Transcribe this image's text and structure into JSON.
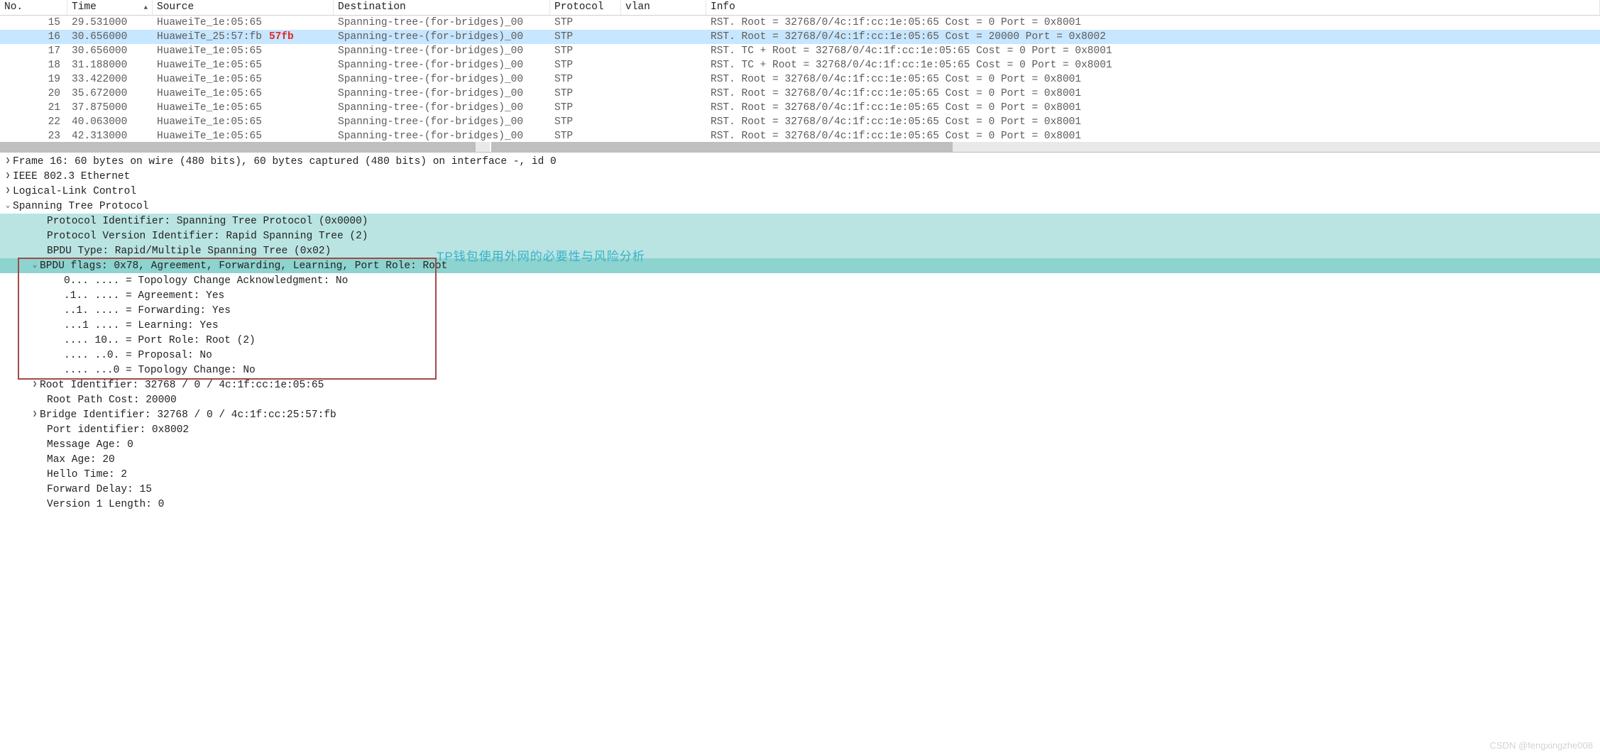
{
  "columns": {
    "no": "No.",
    "time": "Time",
    "src": "Source",
    "dst": "Destination",
    "proto": "Protocol",
    "vlan": "vlan",
    "info": "Info"
  },
  "annot_57fb": "57fb",
  "packets": [
    {
      "no": "15",
      "time": "29.531000",
      "src": "HuaweiTe_1e:05:65",
      "dst": "Spanning-tree-(for-bridges)_00",
      "proto": "STP",
      "info": "RST. Root = 32768/0/4c:1f:cc:1e:05:65  Cost = 0   Port = 0x8001"
    },
    {
      "no": "16",
      "time": "30.656000",
      "src": "HuaweiTe_25:57:fb",
      "dst": "Spanning-tree-(for-bridges)_00",
      "proto": "STP",
      "info": "RST. Root = 32768/0/4c:1f:cc:1e:05:65  Cost = 20000   Port = 0x8002",
      "selected": true
    },
    {
      "no": "17",
      "time": "30.656000",
      "src": "HuaweiTe_1e:05:65",
      "dst": "Spanning-tree-(for-bridges)_00",
      "proto": "STP",
      "info": "RST. TC + Root = 32768/0/4c:1f:cc:1e:05:65  Cost = 0   Port = 0x8001"
    },
    {
      "no": "18",
      "time": "31.188000",
      "src": "HuaweiTe_1e:05:65",
      "dst": "Spanning-tree-(for-bridges)_00",
      "proto": "STP",
      "info": "RST. TC + Root = 32768/0/4c:1f:cc:1e:05:65  Cost = 0   Port = 0x8001"
    },
    {
      "no": "19",
      "time": "33.422000",
      "src": "HuaweiTe_1e:05:65",
      "dst": "Spanning-tree-(for-bridges)_00",
      "proto": "STP",
      "info": "RST. Root = 32768/0/4c:1f:cc:1e:05:65  Cost = 0   Port = 0x8001"
    },
    {
      "no": "20",
      "time": "35.672000",
      "src": "HuaweiTe_1e:05:65",
      "dst": "Spanning-tree-(for-bridges)_00",
      "proto": "STP",
      "info": "RST. Root = 32768/0/4c:1f:cc:1e:05:65  Cost = 0   Port = 0x8001"
    },
    {
      "no": "21",
      "time": "37.875000",
      "src": "HuaweiTe_1e:05:65",
      "dst": "Spanning-tree-(for-bridges)_00",
      "proto": "STP",
      "info": "RST. Root = 32768/0/4c:1f:cc:1e:05:65  Cost = 0   Port = 0x8001"
    },
    {
      "no": "22",
      "time": "40.063000",
      "src": "HuaweiTe_1e:05:65",
      "dst": "Spanning-tree-(for-bridges)_00",
      "proto": "STP",
      "info": "RST. Root = 32768/0/4c:1f:cc:1e:05:65  Cost = 0   Port = 0x8001"
    },
    {
      "no": "23",
      "time": "42.313000",
      "src": "HuaweiTe_1e:05:65",
      "dst": "Spanning-tree-(for-bridges)_00",
      "proto": "STP",
      "info": "RST. Root = 32768/0/4c:1f:cc:1e:05:65  Cost = 0   Port = 0x8001"
    }
  ],
  "tree": {
    "frame": "Frame 16: 60 bytes on wire (480 bits), 60 bytes captured (480 bits) on interface -, id 0",
    "eth": "IEEE 802.3 Ethernet",
    "llc": "Logical-Link Control",
    "stp": "Spanning Tree Protocol",
    "proto_id": "Protocol Identifier: Spanning Tree Protocol (0x0000)",
    "proto_ver": "Protocol Version Identifier: Rapid Spanning Tree (2)",
    "bpdu_type": "BPDU Type: Rapid/Multiple Spanning Tree (0x02)",
    "bpdu_flags": "BPDU flags: 0x78, Agreement, Forwarding, Learning, Port Role: Root",
    "flag_tca": "0... .... = Topology Change Acknowledgment: No",
    "flag_agree": ".1.. .... = Agreement: Yes",
    "flag_fwd": "..1. .... = Forwarding: Yes",
    "flag_learn": "...1 .... = Learning: Yes",
    "flag_role": ".... 10.. = Port Role: Root (2)",
    "flag_prop": ".... ..0. = Proposal: No",
    "flag_tc": ".... ...0 = Topology Change: No",
    "root_id": "Root Identifier: 32768 / 0 / 4c:1f:cc:1e:05:65",
    "root_cost": "Root Path Cost: 20000",
    "bridge_id": "Bridge Identifier: 32768 / 0 / 4c:1f:cc:25:57:fb",
    "port_id": "Port identifier: 0x8002",
    "msg_age": "Message Age: 0",
    "max_age": "Max Age: 20",
    "hello": "Hello Time: 2",
    "fwd_delay": "Forward Delay: 15",
    "v1len": "Version 1 Length: 0"
  },
  "overlay_cn": "TP钱包使用外网的必要性与风险分析",
  "watermark": "CSDN @fengxingzhe008"
}
